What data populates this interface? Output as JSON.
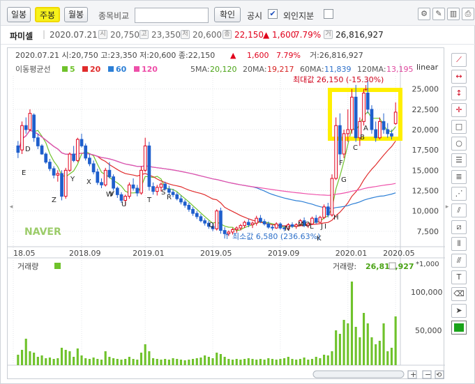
{
  "toolbar": {
    "periods": [
      "일봉",
      "주봉",
      "월봉"
    ],
    "active_period": "주봉",
    "compare_label": "종목비교",
    "compare_input": "",
    "confirm_label": "확인",
    "public_label": "공시",
    "public_checked": "✔",
    "foreign_label": "외인지분"
  },
  "info": {
    "stock_name": "파미셀",
    "date": "2020.07.21",
    "badges": [
      "시",
      "고",
      "저",
      "종",
      "거"
    ],
    "open": "20,750",
    "high": "23,350",
    "low": "20,600",
    "close": "22,150",
    "change": "▲ 1,600",
    "change_pct": "7.79%",
    "volume": "26,816,927"
  },
  "chart_header": {
    "line": "2020.07.21 시:20,750 고:23,350 저:20,600 종:22,150",
    "change": "▲",
    "change_val": "1,600",
    "change_pct": "7.79%",
    "volume": "거:26,816,927",
    "ma_title": "이동평균선",
    "ma_legend": [
      {
        "label": "5",
        "color": "#6fc22b"
      },
      {
        "label": "20",
        "color": "#e02b2b"
      },
      {
        "label": "60",
        "color": "#2c7fd6"
      },
      {
        "label": "120",
        "color": "#ee4fa9"
      }
    ],
    "ma_values": [
      {
        "label": "5MA:",
        "value": "20,120",
        "color": "#4aa315"
      },
      {
        "label": "20MA:",
        "value": "19,217",
        "color": "#d61f1f"
      },
      {
        "label": "60MA:",
        "value": "11,839",
        "color": "#2c6fc9"
      },
      {
        "label": "120MA:",
        "value": "13,195",
        "color": "#e0469e"
      }
    ],
    "scale": "linear",
    "max_label": "최대값 26,150 (-15.30%)",
    "min_label": "최소값 6,580 (236.63%)",
    "logo": "NAVER"
  },
  "volume_panel": {
    "title": "거래량",
    "current_label": "거래량:",
    "current_value": "26,816,927",
    "unit": "*1,000",
    "ticks": [
      "100,000",
      "50,000"
    ]
  },
  "chart_data": {
    "type": "candlestick",
    "x_ticks": [
      "18.05",
      "2018.09",
      "2019.01",
      "2019.05",
      "2019.09",
      "2020.01",
      "2020.05"
    ],
    "y_ticks": [
      7500,
      10000,
      12500,
      15000,
      17500,
      20000,
      22500,
      25000
    ],
    "ylim": [
      5600,
      26600
    ],
    "candles": [
      [
        18.0,
        18.6,
        16.5,
        17.2
      ],
      [
        17.5,
        21.0,
        17.0,
        20.5
      ],
      [
        20.5,
        21.5,
        19.5,
        20.0
      ],
      [
        20.0,
        22.5,
        19.8,
        22.0
      ],
      [
        21.8,
        22.0,
        18.5,
        19.0
      ],
      [
        19.0,
        19.5,
        17.6,
        18.0
      ],
      [
        18.0,
        18.2,
        16.9,
        17.0
      ],
      [
        17.0,
        17.2,
        15.8,
        16.0
      ],
      [
        16.0,
        16.4,
        14.9,
        15.2
      ],
      [
        15.2,
        15.5,
        14.0,
        14.4
      ],
      [
        14.4,
        15.0,
        13.6,
        14.6
      ],
      [
        14.6,
        15.0,
        11.3,
        11.8
      ],
      [
        11.8,
        15.3,
        11.5,
        15.0
      ],
      [
        15.0,
        17.2,
        14.8,
        17.0
      ],
      [
        17.0,
        18.0,
        16.0,
        16.2
      ],
      [
        16.2,
        19.0,
        16.0,
        18.8
      ],
      [
        18.8,
        19.5,
        17.8,
        18.0
      ],
      [
        18.0,
        18.3,
        16.2,
        16.5
      ],
      [
        16.5,
        17.0,
        15.5,
        15.8
      ],
      [
        15.8,
        16.2,
        14.5,
        14.8
      ],
      [
        14.8,
        15.2,
        13.2,
        13.5
      ],
      [
        13.5,
        14.0,
        12.8,
        13.2
      ],
      [
        13.2,
        15.3,
        13.0,
        15.0
      ],
      [
        15.0,
        16.0,
        14.0,
        14.2
      ],
      [
        14.2,
        14.5,
        12.5,
        12.8
      ],
      [
        12.8,
        13.0,
        11.6,
        12.0
      ],
      [
        12.0,
        12.3,
        11.0,
        11.3
      ],
      [
        11.3,
        12.0,
        10.6,
        11.8
      ],
      [
        11.8,
        13.5,
        11.5,
        13.2
      ],
      [
        13.2,
        14.0,
        12.5,
        12.8
      ],
      [
        12.8,
        13.2,
        11.8,
        12.2
      ],
      [
        12.2,
        15.5,
        12.0,
        15.0
      ],
      [
        15.0,
        19.0,
        14.8,
        18.0
      ],
      [
        18.0,
        18.5,
        12.5,
        13.0
      ],
      [
        13.0,
        13.5,
        12.0,
        12.4
      ],
      [
        12.4,
        13.2,
        11.9,
        12.9
      ],
      [
        12.9,
        13.5,
        12.4,
        13.3
      ],
      [
        13.3,
        13.6,
        12.5,
        12.7
      ],
      [
        12.7,
        13.1,
        12.0,
        12.3
      ],
      [
        12.3,
        12.7,
        11.7,
        12.0
      ],
      [
        12.0,
        12.3,
        11.3,
        11.5
      ],
      [
        11.5,
        11.9,
        10.8,
        11.1
      ],
      [
        11.1,
        11.4,
        10.4,
        10.7
      ],
      [
        10.7,
        11.0,
        9.9,
        10.2
      ],
      [
        10.2,
        10.5,
        9.4,
        9.7
      ],
      [
        9.7,
        10.0,
        9.0,
        9.3
      ],
      [
        9.3,
        9.6,
        8.6,
        8.8
      ],
      [
        8.8,
        9.1,
        8.2,
        8.5
      ],
      [
        8.5,
        8.8,
        7.8,
        8.1
      ],
      [
        8.1,
        8.5,
        7.5,
        7.8
      ],
      [
        7.8,
        10.2,
        7.6,
        10.0
      ],
      [
        10.0,
        10.4,
        7.2,
        7.6
      ],
      [
        7.6,
        8.0,
        6.6,
        7.2
      ],
      [
        7.2,
        7.6,
        6.9,
        7.4
      ],
      [
        7.4,
        7.9,
        7.1,
        7.7
      ],
      [
        7.7,
        8.1,
        7.3,
        7.9
      ],
      [
        7.9,
        8.4,
        7.6,
        8.2
      ],
      [
        8.2,
        8.8,
        7.9,
        8.6
      ],
      [
        8.6,
        9.0,
        8.0,
        8.3
      ],
      [
        8.3,
        8.7,
        7.9,
        8.5
      ],
      [
        8.5,
        9.4,
        8.2,
        9.1
      ],
      [
        9.1,
        9.5,
        8.5,
        8.7
      ],
      [
        8.7,
        9.0,
        8.2,
        8.4
      ],
      [
        8.4,
        8.7,
        7.8,
        8.0
      ],
      [
        8.0,
        8.3,
        7.6,
        7.9
      ],
      [
        7.9,
        8.6,
        7.8,
        8.4
      ],
      [
        8.4,
        8.6,
        7.7,
        7.9
      ],
      [
        7.9,
        8.2,
        7.5,
        7.8
      ],
      [
        7.8,
        8.5,
        7.7,
        8.3
      ],
      [
        8.3,
        8.6,
        7.9,
        8.1
      ],
      [
        8.1,
        8.5,
        7.8,
        8.3
      ],
      [
        8.3,
        9.0,
        8.2,
        8.8
      ],
      [
        8.8,
        9.2,
        8.0,
        8.2
      ],
      [
        8.2,
        8.6,
        7.9,
        8.4
      ],
      [
        8.4,
        9.3,
        8.3,
        9.1
      ],
      [
        9.1,
        9.5,
        8.4,
        8.6
      ],
      [
        8.6,
        9.4,
        8.5,
        9.2
      ],
      [
        9.2,
        10.8,
        9.0,
        10.5
      ],
      [
        10.5,
        11.0,
        9.2,
        9.5
      ],
      [
        9.5,
        14.5,
        9.3,
        14.0
      ],
      [
        14.0,
        21.5,
        13.8,
        20.5
      ],
      [
        20.5,
        22.0,
        16.0,
        17.0
      ],
      [
        17.0,
        20.0,
        16.5,
        19.5
      ],
      [
        19.5,
        22.5,
        18.5,
        20.0
      ],
      [
        20.0,
        25.0,
        19.5,
        24.0
      ],
      [
        24.0,
        25.5,
        18.5,
        19.0
      ],
      [
        19.0,
        21.5,
        18.0,
        21.0
      ],
      [
        21.0,
        25.0,
        20.5,
        24.5
      ],
      [
        24.5,
        26.15,
        22.0,
        22.5
      ],
      [
        22.5,
        23.0,
        19.5,
        20.0
      ],
      [
        20.0,
        21.0,
        18.5,
        19.0
      ],
      [
        19.0,
        21.5,
        18.8,
        21.0
      ],
      [
        21.0,
        22.0,
        19.5,
        20.0
      ],
      [
        20.0,
        20.8,
        19.0,
        19.5
      ],
      [
        19.5,
        20.0,
        18.8,
        19.2
      ],
      [
        20.75,
        23.35,
        20.6,
        22.15
      ]
    ],
    "volume_unit": "thousand shares",
    "volume": [
      15,
      22,
      38,
      20,
      18,
      12,
      14,
      10,
      11,
      9,
      10,
      25,
      22,
      20,
      12,
      24,
      14,
      10,
      9,
      11,
      9,
      8,
      20,
      12,
      10,
      9,
      8,
      9,
      12,
      9,
      8,
      18,
      30,
      20,
      10,
      9,
      8,
      9,
      8,
      10,
      9,
      8,
      7,
      8,
      9,
      10,
      11,
      14,
      12,
      10,
      18,
      16,
      12,
      9,
      8,
      9,
      8,
      9,
      10,
      9,
      8,
      9,
      8,
      10,
      9,
      8,
      9,
      10,
      12,
      9,
      8,
      9,
      11,
      8,
      9,
      12,
      10,
      15,
      14,
      20,
      50,
      45,
      65,
      60,
      120,
      55,
      40,
      75,
      60,
      40,
      30,
      35,
      60,
      20,
      25,
      70
    ],
    "annotations": [
      "A",
      "B",
      "C",
      "D",
      "E",
      "F",
      "G",
      "H",
      "I",
      "J",
      "K",
      "L",
      "M",
      "N",
      "O",
      "Q",
      "R",
      "S",
      "T",
      "U",
      "V",
      "W",
      "X",
      "Y",
      "Z"
    ]
  }
}
